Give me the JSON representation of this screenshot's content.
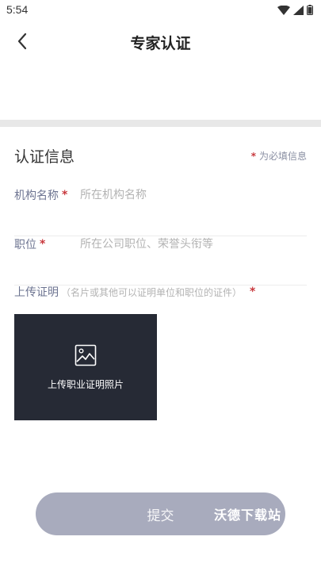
{
  "status_bar": {
    "time": "5:54"
  },
  "header": {
    "title": "专家认证"
  },
  "section": {
    "title": "认证信息",
    "required_note": "为必填信息",
    "star": "*"
  },
  "fields": {
    "org": {
      "label": "机构名称",
      "star": "*",
      "placeholder": "所在机构名称",
      "value": ""
    },
    "position": {
      "label": "职位",
      "star": "*",
      "placeholder": "所在公司职位、荣誉头衔等",
      "value": ""
    }
  },
  "upload": {
    "label": "上传证明",
    "hint": "（名片或其他可以证明单位和职位的证件）",
    "star": "*",
    "button_text": "上传职业证明照片"
  },
  "submit": {
    "label": "提交"
  },
  "watermark": {
    "text": "沃德下载站"
  },
  "colors": {
    "accent_star": "#c8383d",
    "submit_bg": "#a8abbd",
    "upload_bg": "#262a35"
  }
}
